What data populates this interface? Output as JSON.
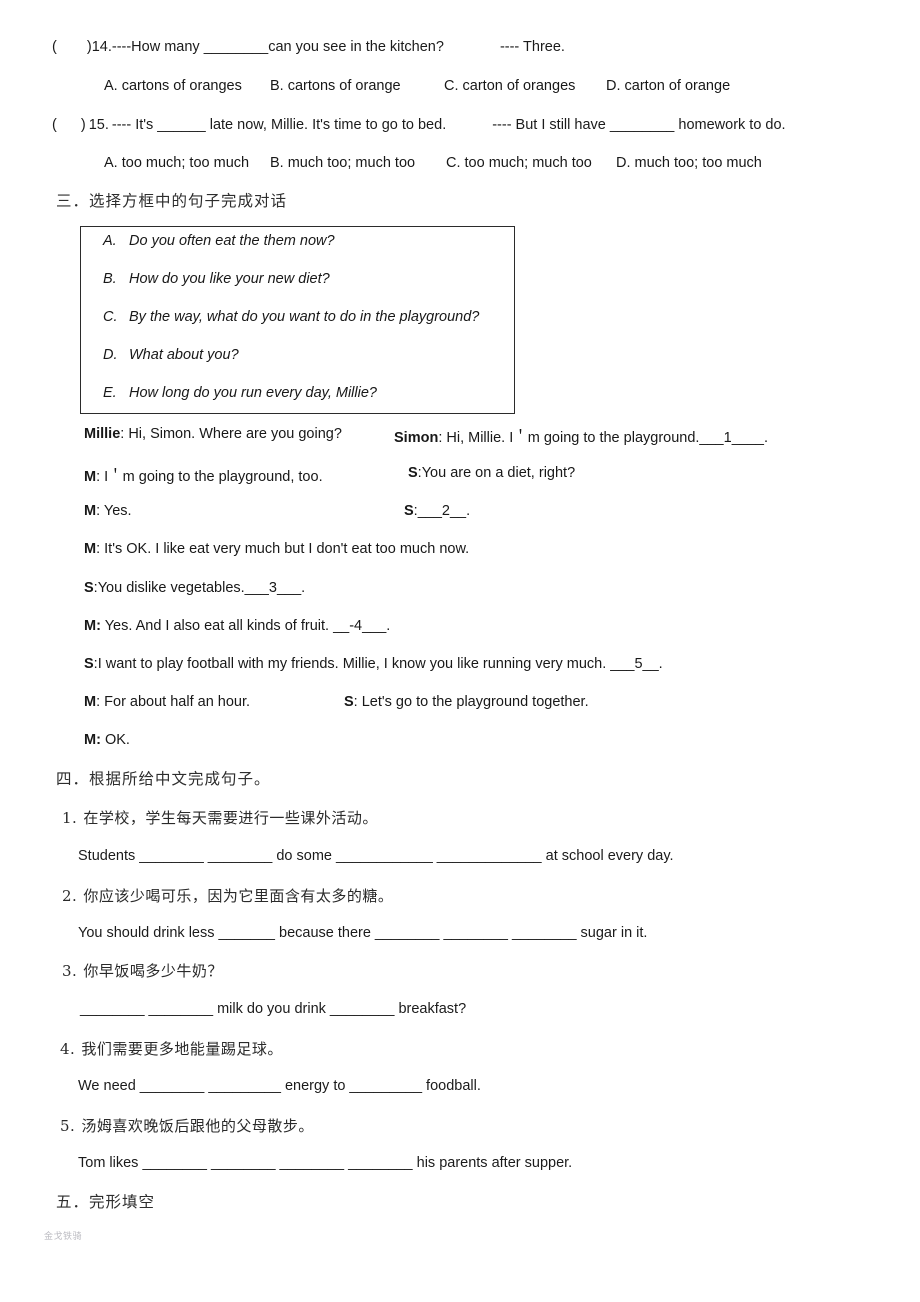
{
  "document": {
    "background_color": "#ffffff",
    "text_color": "#1b1b1b",
    "watermark": "金戈铁骑"
  },
  "multiple_choice": [
    {
      "bracket": "(",
      "close_bracket": ")",
      "number": "14.",
      "stem": "----How many ________can you see in the kitchen?",
      "answer_hint": "---- Three.",
      "options": [
        "A.  cartons of oranges",
        "B. cartons of orange",
        "C. carton of oranges",
        "D. carton of orange"
      ]
    },
    {
      "bracket": "(",
      "close_bracket": ")",
      "number": "15.",
      "stem": "---- It's ______ late now, Millie. It's time to go to bed.",
      "answer_hint": "---- But I still have ________ homework to do.",
      "options": [
        "A.   too much; too much",
        "B. much too; much too",
        "C. too much; much too",
        "D. much too; too much"
      ]
    }
  ],
  "section_three": {
    "heading": "三．选择方框中的句子完成对话",
    "box_options": [
      {
        "label": "A.",
        "text": "Do you often eat the them now?"
      },
      {
        "label": "B.",
        "text": "How do you like your new diet?"
      },
      {
        "label": "C.",
        "text": "By the way, what do you want to do in the playground?"
      },
      {
        "label": "D.",
        "text": "What about you?"
      },
      {
        "label": "E.",
        "text": "How long do you run every day, Millie?"
      }
    ],
    "dialogue": [
      {
        "left_speaker": "Millie",
        "left_text": ": Hi, Simon. Where are you going?",
        "right_speaker": "Simon",
        "right_text": ": Hi, Millie. I＇m going to the playground.___1____."
      },
      {
        "left_speaker": "M",
        "left_text": ": I＇m going to the playground, too.",
        "right_speaker": "S",
        "right_text": ":You are on a diet, right?"
      },
      {
        "left_speaker": "M",
        "left_text": ": Yes.",
        "right_speaker": "S",
        "right_text": ":___2__."
      },
      {
        "left_speaker": "M",
        "left_text": ": It's OK. I like eat very much but I don't eat too much now.",
        "right_speaker": "",
        "right_text": ""
      },
      {
        "left_speaker": "S",
        "left_text": ":You dislike vegetables.___3___.",
        "right_speaker": "",
        "right_text": ""
      },
      {
        "left_speaker": "M:",
        "left_text": " Yes. And I also eat all kinds of fruit. __-4___.",
        "right_speaker": "",
        "right_text": ""
      },
      {
        "left_speaker": "S",
        "left_text": ":I want to play football with my friends. Millie, I know you like running very much. ___5__.",
        "right_speaker": "",
        "right_text": ""
      },
      {
        "left_speaker": "M",
        "left_text": ": For about half an hour.",
        "right_speaker": "S",
        "right_text": ": Let's go to the playground together."
      },
      {
        "left_speaker": "M:",
        "left_text": " OK.",
        "right_speaker": "",
        "right_text": ""
      }
    ]
  },
  "section_four": {
    "heading": "四．根据所给中文完成句子。",
    "items": [
      {
        "number": "1.",
        "chinese": "在学校，学生每天需要进行一些课外活动。",
        "english": "Students ________ ________ do some ____________ _____________ at school every day."
      },
      {
        "number": "2.",
        "chinese": "你应该少喝可乐，因为它里面含有太多的糖。",
        "english": "You should drink less _______ because there ________ ________ ________ sugar in it."
      },
      {
        "number": "3.",
        "chinese": "你早饭喝多少牛奶？",
        "english": "________ ________ milk do you drink ________ breakfast?"
      },
      {
        "number": "4.",
        "chinese": "我们需要更多地能量踢足球。",
        "english": "We need ________ _________ energy to _________ foodball."
      },
      {
        "number": "5.",
        "chinese": "汤姆喜欢晚饭后跟他的父母散步。",
        "english": "Tom likes ________ ________ ________ ________ his parents after supper."
      }
    ]
  },
  "section_five": {
    "heading": "五．完形填空"
  }
}
